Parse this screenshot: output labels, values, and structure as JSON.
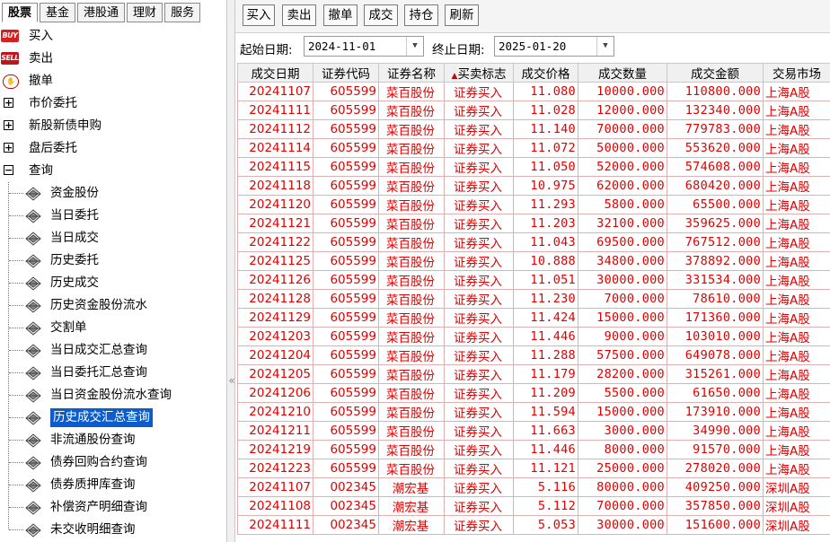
{
  "tabs": [
    "股票",
    "基金",
    "港股通",
    "理财",
    "服务"
  ],
  "active_tab": 0,
  "tree": {
    "buy": "买入",
    "sell": "卖出",
    "cancel": "撤单",
    "market_order": "市价委托",
    "ipo": "新股新债申购",
    "after_hours": "盘后委托",
    "query": "查询",
    "query_items": [
      "资金股份",
      "当日委托",
      "当日成交",
      "历史委托",
      "历史成交",
      "历史资金股份流水",
      "交割单",
      "当日成交汇总查询",
      "当日委托汇总查询",
      "当日资金股份流水查询",
      "历史成交汇总查询",
      "非流通股份查询",
      "债券回购合约查询",
      "债券质押库查询",
      "补偿资产明细查询",
      "未交收明细查询"
    ],
    "selected_index": 10,
    "icon_buy_text": "BUY",
    "icon_sell_text": "SELL"
  },
  "toolbar": {
    "buy": "买入",
    "sell": "卖出",
    "cancel": "撤单",
    "deal": "成交",
    "position": "持仓",
    "refresh": "刷新"
  },
  "filter": {
    "start_label": "起始日期:",
    "start_value": "2024-11-01",
    "end_label": "终止日期:",
    "end_value": "2025-01-20"
  },
  "table": {
    "columns": [
      "成交日期",
      "证券代码",
      "证券名称",
      "买卖标志",
      "成交价格",
      "成交数量",
      "成交金额",
      "交易市场"
    ],
    "sort_col": 3,
    "rows": [
      [
        "20241107",
        "605599",
        "菜百股份",
        "证券买入",
        "11.080",
        "10000.000",
        "110800.000",
        "上海A股"
      ],
      [
        "20241111",
        "605599",
        "菜百股份",
        "证券买入",
        "11.028",
        "12000.000",
        "132340.000",
        "上海A股"
      ],
      [
        "20241112",
        "605599",
        "菜百股份",
        "证券买入",
        "11.140",
        "70000.000",
        "779783.000",
        "上海A股"
      ],
      [
        "20241114",
        "605599",
        "菜百股份",
        "证券买入",
        "11.072",
        "50000.000",
        "553620.000",
        "上海A股"
      ],
      [
        "20241115",
        "605599",
        "菜百股份",
        "证券买入",
        "11.050",
        "52000.000",
        "574608.000",
        "上海A股"
      ],
      [
        "20241118",
        "605599",
        "菜百股份",
        "证券买入",
        "10.975",
        "62000.000",
        "680420.000",
        "上海A股"
      ],
      [
        "20241120",
        "605599",
        "菜百股份",
        "证券买入",
        "11.293",
        "5800.000",
        "65500.000",
        "上海A股"
      ],
      [
        "20241121",
        "605599",
        "菜百股份",
        "证券买入",
        "11.203",
        "32100.000",
        "359625.000",
        "上海A股"
      ],
      [
        "20241122",
        "605599",
        "菜百股份",
        "证券买入",
        "11.043",
        "69500.000",
        "767512.000",
        "上海A股"
      ],
      [
        "20241125",
        "605599",
        "菜百股份",
        "证券买入",
        "10.888",
        "34800.000",
        "378892.000",
        "上海A股"
      ],
      [
        "20241126",
        "605599",
        "菜百股份",
        "证券买入",
        "11.051",
        "30000.000",
        "331534.000",
        "上海A股"
      ],
      [
        "20241128",
        "605599",
        "菜百股份",
        "证券买入",
        "11.230",
        "7000.000",
        "78610.000",
        "上海A股"
      ],
      [
        "20241129",
        "605599",
        "菜百股份",
        "证券买入",
        "11.424",
        "15000.000",
        "171360.000",
        "上海A股"
      ],
      [
        "20241203",
        "605599",
        "菜百股份",
        "证券买入",
        "11.446",
        "9000.000",
        "103010.000",
        "上海A股"
      ],
      [
        "20241204",
        "605599",
        "菜百股份",
        "证券买入",
        "11.288",
        "57500.000",
        "649078.000",
        "上海A股"
      ],
      [
        "20241205",
        "605599",
        "菜百股份",
        "证券买入",
        "11.179",
        "28200.000",
        "315261.000",
        "上海A股"
      ],
      [
        "20241206",
        "605599",
        "菜百股份",
        "证券买入",
        "11.209",
        "5500.000",
        "61650.000",
        "上海A股"
      ],
      [
        "20241210",
        "605599",
        "菜百股份",
        "证券买入",
        "11.594",
        "15000.000",
        "173910.000",
        "上海A股"
      ],
      [
        "20241211",
        "605599",
        "菜百股份",
        "证券买入",
        "11.663",
        "3000.000",
        "34990.000",
        "上海A股"
      ],
      [
        "20241219",
        "605599",
        "菜百股份",
        "证券买入",
        "11.446",
        "8000.000",
        "91570.000",
        "上海A股"
      ],
      [
        "20241223",
        "605599",
        "菜百股份",
        "证券买入",
        "11.121",
        "25000.000",
        "278020.000",
        "上海A股"
      ],
      [
        "20241107",
        "002345",
        "潮宏基",
        "证券买入",
        "5.116",
        "80000.000",
        "409250.000",
        "深圳A股"
      ],
      [
        "20241108",
        "002345",
        "潮宏基",
        "证券买入",
        "5.112",
        "70000.000",
        "357850.000",
        "深圳A股"
      ],
      [
        "20241111",
        "002345",
        "潮宏基",
        "证券买入",
        "5.053",
        "30000.000",
        "151600.000",
        "深圳A股"
      ]
    ]
  },
  "colors": {
    "row_text": "#e00000",
    "selection": "#0b5ccd"
  }
}
